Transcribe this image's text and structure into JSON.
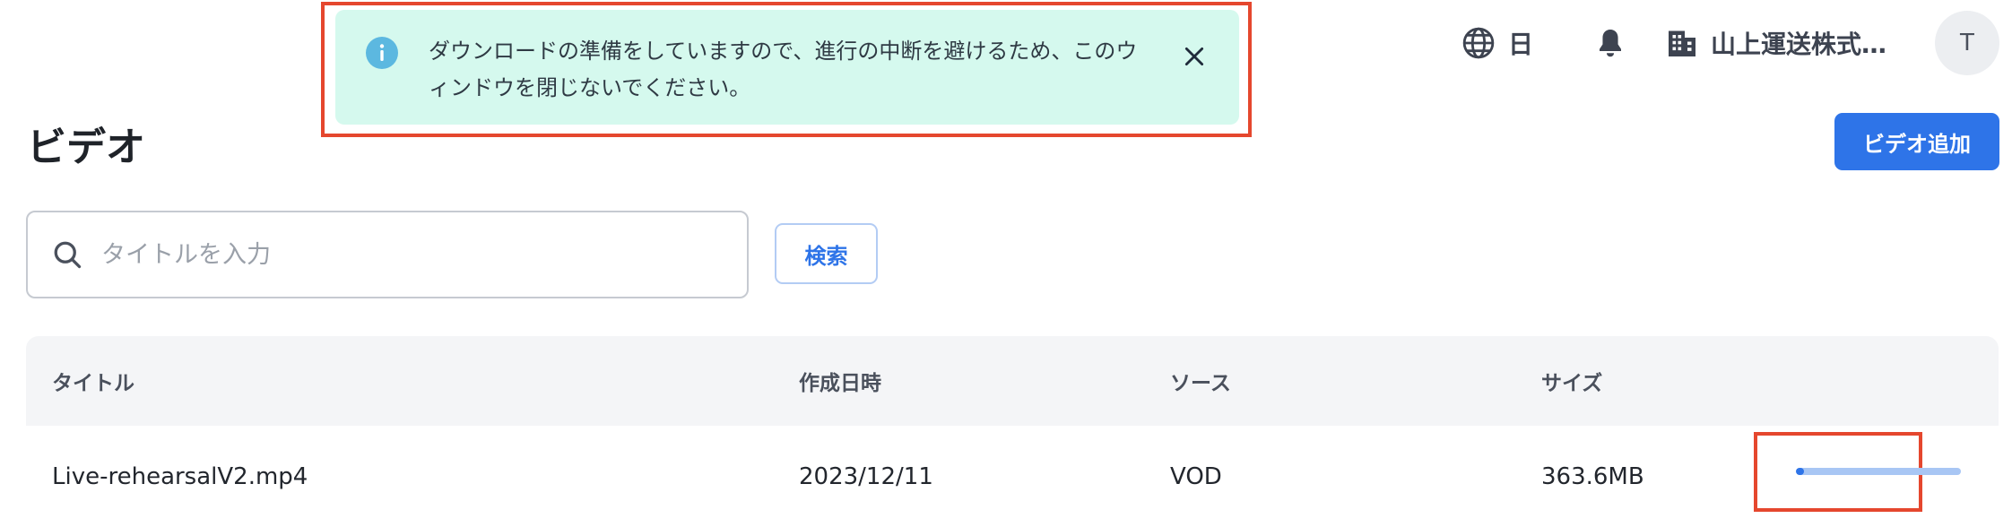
{
  "header": {
    "language_label": "日",
    "company_label": "山上運送株式会社",
    "avatar_initial": "T"
  },
  "toast": {
    "message": "ダウンロードの準備をしていますので、進行の中断を避けるため、このウィンドウを閉じないでください。"
  },
  "page": {
    "title": "ビデオ",
    "add_button_label": "ビデオ追加"
  },
  "search": {
    "placeholder": "タイトルを入力",
    "value": "",
    "button_label": "検索"
  },
  "table": {
    "columns": [
      "タイトル",
      "作成日時",
      "ソース",
      "サイズ"
    ],
    "rows": [
      {
        "title": "Live-rehearsalV2.mp4",
        "created_at": "2023/12/11",
        "source": "VOD",
        "size": "363.6MB",
        "download_progress": 0.05
      }
    ]
  },
  "colors": {
    "accent": "#2e74e8",
    "toast_background": "#d5f9ee",
    "info_icon": "#5cb8e0",
    "highlight": "#e5472e",
    "progress_track": "#a8c6f4"
  },
  "icons": {
    "language": "globe-icon",
    "notifications": "bell-icon",
    "company": "building-icon",
    "toast_info": "info-icon",
    "toast_close": "close-icon",
    "search": "search-icon"
  }
}
